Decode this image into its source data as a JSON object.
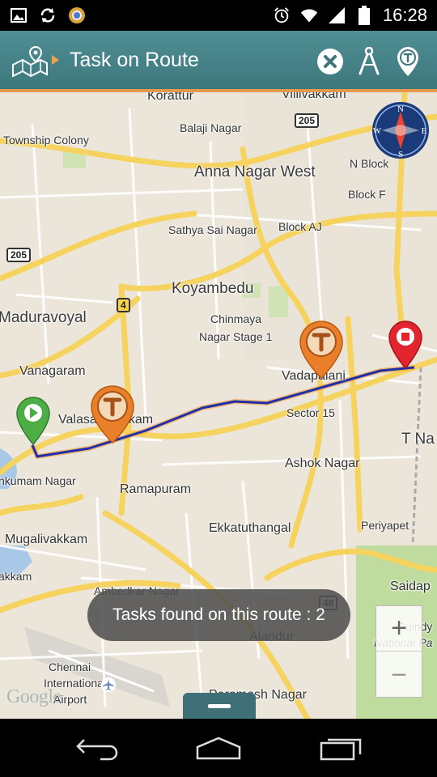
{
  "status_bar": {
    "time": "16:28",
    "left_icons": [
      "image-icon",
      "sync-icon",
      "chrome-icon"
    ],
    "right_icons": [
      "alarm-icon",
      "wifi-icon",
      "signal-icon",
      "battery-icon"
    ]
  },
  "action_bar": {
    "title": "Task on Route",
    "icons": [
      "app-map-logo-icon",
      "close-icon",
      "drafting-compass-icon",
      "task-pin-icon"
    ],
    "accent_color": "#4a878c",
    "underline_color": "#e39a4e"
  },
  "map": {
    "labels": {
      "korattur": "Korattur",
      "villivakkam": "Villivakkam",
      "balaji_nagar": "Balaji Nagar",
      "township_colony": "Township Colony",
      "anna_nagar_west": "Anna Nagar West",
      "n_block": "N Block",
      "block_f": "Block F",
      "sathya_sai_nagar": "Sathya Sai Nagar",
      "block_aj": "Block AJ",
      "koyambedu": "Koyambedu",
      "maduravoyal": "Maduravoyal",
      "chinmaya_1": "Chinmaya",
      "chinmaya_2": "Nagar Stage 1",
      "vanagaram": "Vanagaram",
      "vadapalani": "Vadapalani",
      "valasaravakkam": "Valasaravakkam",
      "sector_15": "Sector 15",
      "t_nagar": "T Na",
      "ashok_nagar": "Ashok Nagar",
      "nkumam_nagar": "nkumam Nagar",
      "ramapuram": "Ramapuram",
      "mugalivakkam": "Mugalivakkam",
      "ekkatuthangal": "Ekkatuthangal",
      "periyapet": "Periyapet",
      "akkam": "akkam",
      "ambedkar_nagar": "Ambedkar Nagar",
      "saidap": "Saidap",
      "guindy": "Guindy",
      "national_park": "National Pa",
      "alandur": "Alandur",
      "chennai_airport_1": "Chennai",
      "chennai_airport_2": "International",
      "chennai_airport_3": "Airport",
      "paramesh_nagar": "Paramesh Nagar"
    },
    "shields": {
      "s205_top": "205",
      "s205_left": "205",
      "s4": "4",
      "s48": "48"
    },
    "markers": [
      "start-marker",
      "task-marker",
      "task-marker",
      "destination-marker"
    ],
    "route_color": "#1f2fa8",
    "attribution": "Google"
  },
  "toast": {
    "text": "Tasks found on this route : 2"
  },
  "zoom": {
    "in_label": "+",
    "out_label": "−"
  }
}
